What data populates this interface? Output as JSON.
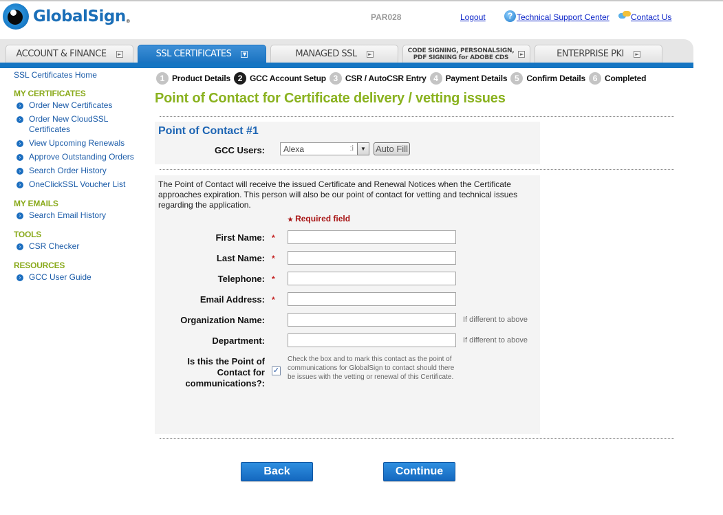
{
  "brand": {
    "name": "GlobalSign",
    "trademark": "®",
    "accent": "#1575c2",
    "green": "#8ab21f"
  },
  "header": {
    "account_id": "PAR028",
    "logout": "Logout",
    "support": "Technical Support Center",
    "contact": "Contact Us",
    "support_icon": "help-icon",
    "contact_icon": "chat-bubbles-icon"
  },
  "nav": {
    "tabs": [
      {
        "label": "ACCOUNT & FINANCE",
        "active": false
      },
      {
        "label": "SSL CERTIFICATES",
        "active": true
      },
      {
        "label": "MANAGED SSL",
        "active": false
      },
      {
        "label": "CODE SIGNING, PERSONALSIGN,",
        "label2": "PDF SIGNING for ADOBE CDS",
        "active": false
      },
      {
        "label": "ENTERPRISE PKI",
        "active": false
      }
    ]
  },
  "sidebar": {
    "home": "SSL Certificates Home",
    "sections": [
      {
        "title": "MY CERTIFICATES",
        "items": [
          "Order New Certificates",
          "Order New CloudSSL Certificates",
          "View Upcoming Renewals",
          "Approve Outstanding Orders",
          "Search Order History",
          "OneClickSSL Voucher List"
        ]
      },
      {
        "title": "MY EMAILS",
        "items": [
          "Search Email History"
        ]
      },
      {
        "title": "TOOLS",
        "items": [
          "CSR Checker"
        ]
      },
      {
        "title": "RESOURCES",
        "items": [
          "GCC User Guide"
        ]
      }
    ]
  },
  "steps": [
    {
      "num": "1",
      "label": "Product Details"
    },
    {
      "num": "2",
      "label": "GCC Account Setup",
      "active": true
    },
    {
      "num": "3",
      "label": "CSR / AutoCSR Entry"
    },
    {
      "num": "4",
      "label": "Payment Details"
    },
    {
      "num": "5",
      "label": "Confirm Details"
    },
    {
      "num": "6",
      "label": "Completed"
    }
  ],
  "page_title": "Point of Contact for Certificate delivery / vetting issues",
  "poc": {
    "title": "Point of Contact #1",
    "gcc_users_label": "GCC Users:",
    "gcc_users_value": "Alexa",
    "gcc_users_clip": ":i",
    "autofill": "Auto Fill"
  },
  "form": {
    "description": "The Point of Contact will receive the issued Certificate and Renewal Notices when the Certificate approaches expiration. This person will also be our point of contact for vetting and technical issues regarding the application.",
    "required_note": "Required field",
    "required_star": "*",
    "fields": [
      {
        "label": "First Name:",
        "required": true,
        "value": ""
      },
      {
        "label": "Last Name:",
        "required": true,
        "value": ""
      },
      {
        "label": "Telephone:",
        "required": true,
        "value": ""
      },
      {
        "label": "Email Address:",
        "required": true,
        "value": ""
      },
      {
        "label": "Organization Name:",
        "required": false,
        "value": "",
        "hint": "If different to above"
      },
      {
        "label": "Department:",
        "required": false,
        "value": "",
        "hint": "If different to above"
      }
    ],
    "poc_comm_label_1": "Is this the Point of",
    "poc_comm_label_2": "Contact for",
    "poc_comm_label_3": "communications?:",
    "poc_comm_checked": true,
    "poc_comm_check_glyph": "✓",
    "poc_comm_desc": "Check the box and to mark this contact as the point of communications for GlobalSign to contact should there be issues with the vetting or renewal of this Certificate."
  },
  "buttons": {
    "back": "Back",
    "continue": "Continue"
  }
}
